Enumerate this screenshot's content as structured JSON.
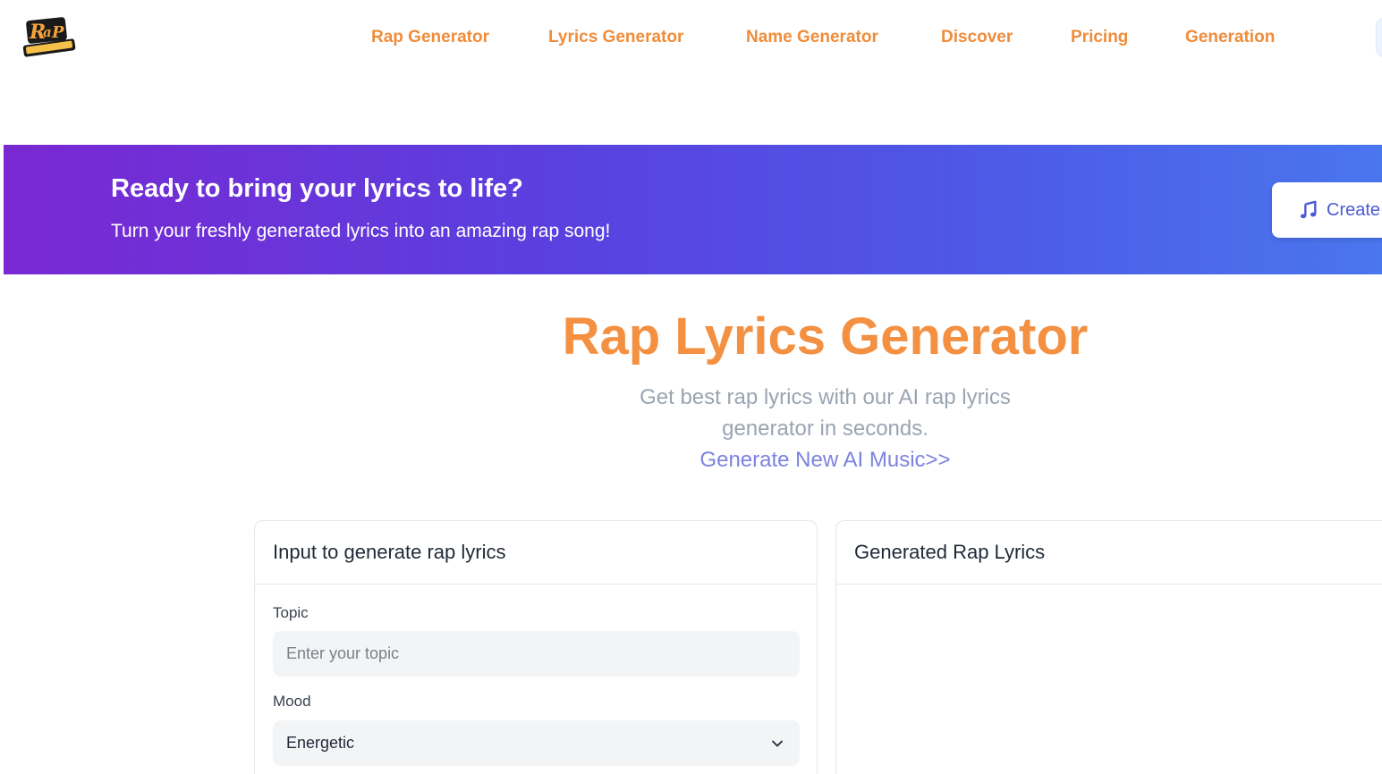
{
  "header": {
    "logo_text": "Rap Generator",
    "nav": [
      {
        "label": "Rap Generator"
      },
      {
        "label": "Lyrics Generator"
      },
      {
        "label": "Name Generator"
      },
      {
        "label": "Discover"
      },
      {
        "label": "Pricing"
      },
      {
        "label": "Generation"
      }
    ]
  },
  "banner": {
    "title": "Ready to bring your lyrics to life?",
    "subtitle": "Turn your freshly generated lyrics into an amazing rap song!",
    "create_label": "Create",
    "icon": "music-note-icon"
  },
  "hero": {
    "title": "Rap Lyrics Generator",
    "subtitle_line1": "Get best rap lyrics with our AI rap lyrics",
    "subtitle_line2": "generator in seconds.",
    "link": "Generate New AI Music>>"
  },
  "input_card": {
    "title": "Input to generate rap lyrics",
    "topic_label": "Topic",
    "topic_placeholder": "Enter your topic",
    "topic_value": "",
    "mood_label": "Mood",
    "mood_value": "Energetic"
  },
  "output_card": {
    "title": "Generated Rap Lyrics"
  },
  "colors": {
    "accent_orange": "#f08c3a",
    "banner_start": "#7a28d2",
    "banner_end": "#4a76ee",
    "link_blue": "#7b83e0"
  }
}
